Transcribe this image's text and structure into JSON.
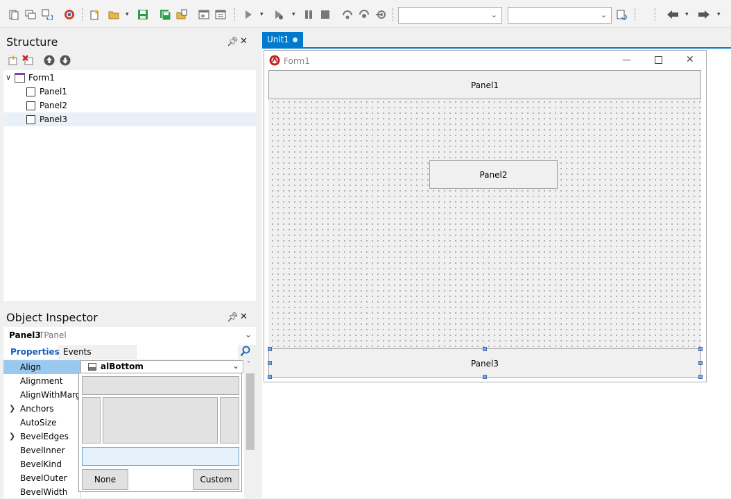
{
  "toolbar": {
    "icons": [
      "new-items-icon",
      "open-project-icon",
      "reopen-icon",
      "help-icon",
      "new-file-icon",
      "open-folder-icon",
      "save-icon",
      "save-all-icon",
      "open-file-icon",
      "toggle-form-icon",
      "view-form-icon",
      "run-icon",
      "run-without-debug-icon",
      "pause-icon",
      "stop-icon",
      "step-over-icon",
      "trace-into-icon",
      "run-to-cursor-icon",
      "refresh-icon",
      "back-icon",
      "forward-icon"
    ],
    "combo1_value": "",
    "combo2_value": ""
  },
  "structure": {
    "title": "Structure",
    "tree": [
      {
        "label": "Form1",
        "level": 0
      },
      {
        "label": "Panel1",
        "level": 1
      },
      {
        "label": "Panel2",
        "level": 1
      },
      {
        "label": "Panel3",
        "level": 1
      }
    ]
  },
  "object_inspector": {
    "title": "Object Inspector",
    "selected_name": "Panel3",
    "selected_type": "TPanel",
    "tabs": [
      "Properties",
      "Events"
    ],
    "properties": [
      "Align",
      "Alignment",
      "AlignWithMargins",
      "Anchors",
      "AutoSize",
      "BevelEdges",
      "BevelInner",
      "BevelKind",
      "BevelOuter",
      "BevelWidth"
    ],
    "expandable": [
      "Anchors",
      "BevelEdges"
    ],
    "align_value": "alBottom",
    "popup": {
      "none_label": "None",
      "custom_label": "Custom"
    }
  },
  "editor": {
    "tab_label": "Unit1",
    "form_caption": "Form1",
    "panels": [
      "Panel1",
      "Panel2",
      "Panel3"
    ]
  },
  "colors": {
    "accent": "#007acc",
    "selection": "#99c9ef"
  }
}
